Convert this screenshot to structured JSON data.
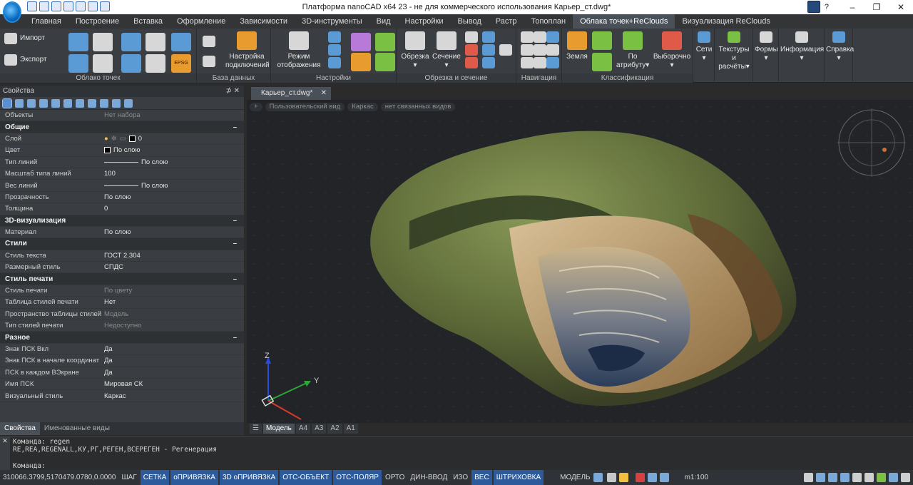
{
  "window": {
    "title": "Платформа nanoCAD x64 23 - не для коммерческого использования Карьер_ст.dwg*",
    "help": "?",
    "min": "–",
    "max": "❐",
    "close": "✕"
  },
  "ribbon_tabs": [
    "Главная",
    "Построение",
    "Вставка",
    "Оформление",
    "Зависимости",
    "3D-инструменты",
    "Вид",
    "Настройки",
    "Вывод",
    "Растр",
    "Топоплан",
    "Облака точек+ReClouds",
    "Визуализация ReClouds"
  ],
  "ribbon": {
    "import": "Импорт",
    "export": "Экспорт",
    "g_cloud": "Облако точек",
    "conn_settings": "Настройка подключений",
    "g_db": "База данных",
    "display_mode": "Режим отображения",
    "g_settings": "Настройки",
    "cut": "Обрезка",
    "section": "Сечение",
    "g_cut": "Обрезка и сечение",
    "g_nav": "Навигация",
    "ground": "Земля",
    "by_attr": "По атрибуту",
    "selective": "Выборочно",
    "g_class": "Классификация",
    "nets": "Сети",
    "textures": "Текстуры и расчёты",
    "forms": "Формы",
    "info": "Информация",
    "help": "Справка",
    "epsg": "EPSG"
  },
  "props": {
    "title": "Свойства",
    "pin": "⊅  ✕",
    "objects_key": "Объекты",
    "objects_val": "Нет набора",
    "general": "Общие",
    "layer_k": "Слой",
    "layer_v": "0",
    "color_k": "Цвет",
    "color_v": "По слою",
    "linetype_k": "Тип линий",
    "linetype_v": "По слою",
    "ltscale_k": "Масштаб типа линий",
    "ltscale_v": "100",
    "lweight_k": "Вес линий",
    "lweight_v": "По слою",
    "transp_k": "Прозрачность",
    "transp_v": "По слою",
    "thick_k": "Толщина",
    "thick_v": "0",
    "vis3d": "3D-визуализация",
    "mat_k": "Материал",
    "mat_v": "По слою",
    "styles": "Стили",
    "tstyle_k": "Стиль текста",
    "tstyle_v": "ГОСТ 2.304",
    "dstyle_k": "Размерный стиль",
    "dstyle_v": "СПДС",
    "plotstyle": "Стиль печати",
    "ps_k": "Стиль печати",
    "ps_v": "По цвету",
    "pst_k": "Таблица стилей печати",
    "pst_v": "Нет",
    "psp_k": "Пространство таблицы стилей п...",
    "psp_v": "Модель",
    "pstype_k": "Тип стилей печати",
    "pstype_v": "Недоступно",
    "misc": "Разное",
    "ucs_on_k": "Знак ПСК Вкл",
    "ucs_on_v": "Да",
    "ucs_org_k": "Знак ПСК в начале координат",
    "ucs_org_v": "Да",
    "ucs_vp_k": "ПСК в каждом ВЭкране",
    "ucs_vp_v": "Да",
    "ucs_name_k": "Имя ПСК",
    "ucs_name_v": "Мировая СК",
    "vstyle_k": "Визуальный стиль",
    "vstyle_v": "Каркас",
    "minus": "–",
    "tab_props": "Свойства",
    "tab_views": "Именованные виды"
  },
  "doc": {
    "tab": "Карьер_ст.dwg*",
    "close": "✕",
    "vp_plus": "+",
    "vp_view": "Пользовательский вид",
    "vp_style": "Каркас",
    "vp_link": "нет связанных видов",
    "axis_z": "Z",
    "axis_y": "Y",
    "model_tabs": [
      "Модель",
      "A4",
      "A3",
      "A2",
      "A1"
    ]
  },
  "cmd": {
    "side": "✕",
    "line1": "Команда: regen",
    "line2": "RE,REA,REGENALL,КУ,РГ,РЕГЕН,ВСЕРЕГЕН - Регенерация",
    "line3": "Команда:"
  },
  "status": {
    "coords": "310066.3799,5170479.0780,0.0000",
    "items": [
      {
        "label": "ШАГ",
        "on": false
      },
      {
        "label": "СЕТКА",
        "on": true
      },
      {
        "label": "оПРИВЯЗКА",
        "on": true
      },
      {
        "label": "3D оПРИВЯЗКА",
        "on": true
      },
      {
        "label": "ОТС-ОБЪЕКТ",
        "on": true
      },
      {
        "label": "ОТС-ПОЛЯР",
        "on": true
      },
      {
        "label": "ОРТО",
        "on": false
      },
      {
        "label": "ДИН-ВВОД",
        "on": false
      },
      {
        "label": "ИЗО",
        "on": false
      },
      {
        "label": "ВЕС",
        "on": true
      },
      {
        "label": "ШТРИХОВКА",
        "on": true
      }
    ],
    "model": "МОДЕЛЬ",
    "scale": "m1:100"
  },
  "colors": {
    "accent": "#2c5a9a",
    "panel": "#3a3d41",
    "viewport": "#222427"
  }
}
